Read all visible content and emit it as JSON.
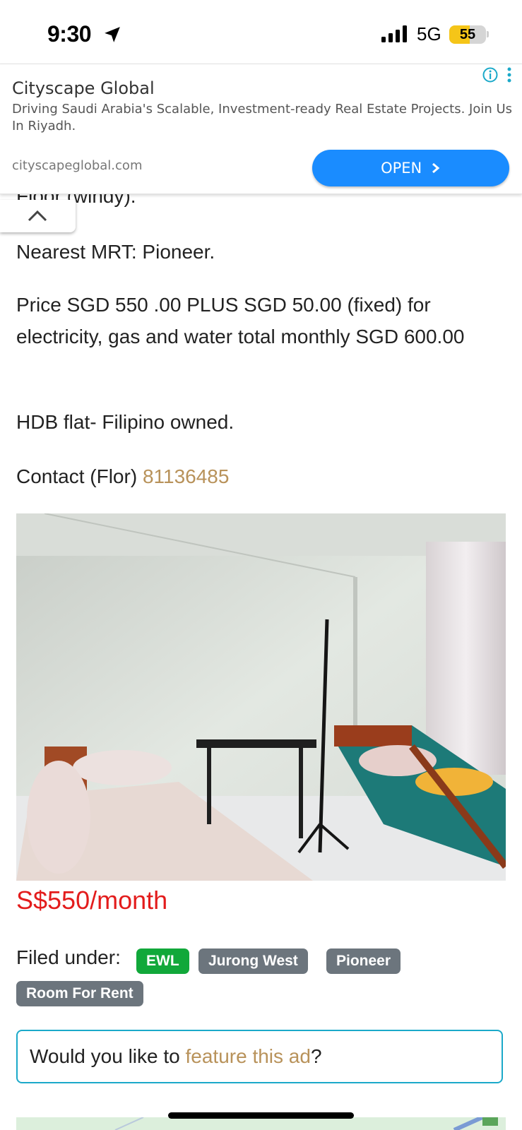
{
  "status_bar": {
    "time": "9:30",
    "network": "5G",
    "battery": "55",
    "battery_level": 0.55
  },
  "ad": {
    "title": "Cityscape Global",
    "description": "Driving Saudi Arabia's Scalable, Investment-ready Real Estate Projects. Join Us In Riyadh.",
    "domain": "cityscapeglobal.com",
    "open_label": "OPEN",
    "open_icon": "chevron-right-icon",
    "info_icon": "info-icon",
    "more_icon": "more-vertical-icon"
  },
  "collapse_icon": "chevron-up-icon",
  "listing": {
    "partial_line": "Floor (windy).",
    "mrt": "Nearest MRT: Pioneer.",
    "price_text": "Price SGD 550 .00 PLUS SGD 50.00 (fixed) for electricity, gas and water total monthly SGD 600.00",
    "hdb": "HDB flat- Filipino owned.",
    "contact_label": "Contact (Flor)",
    "contact_phone": "81136485",
    "price": "S$550/month",
    "filed_under": "Filed under:",
    "tags": [
      {
        "label": "EWL",
        "color": "#11a83a"
      },
      {
        "label": "Jurong West",
        "color": "#6c757d"
      },
      {
        "label": "Pioneer",
        "color": "#6c757d"
      },
      {
        "label": "Room For Rent",
        "color": "#6c757d"
      }
    ],
    "feature_prefix": "Would you like to",
    "feature_link": "feature this ad",
    "feature_suffix": "?"
  }
}
